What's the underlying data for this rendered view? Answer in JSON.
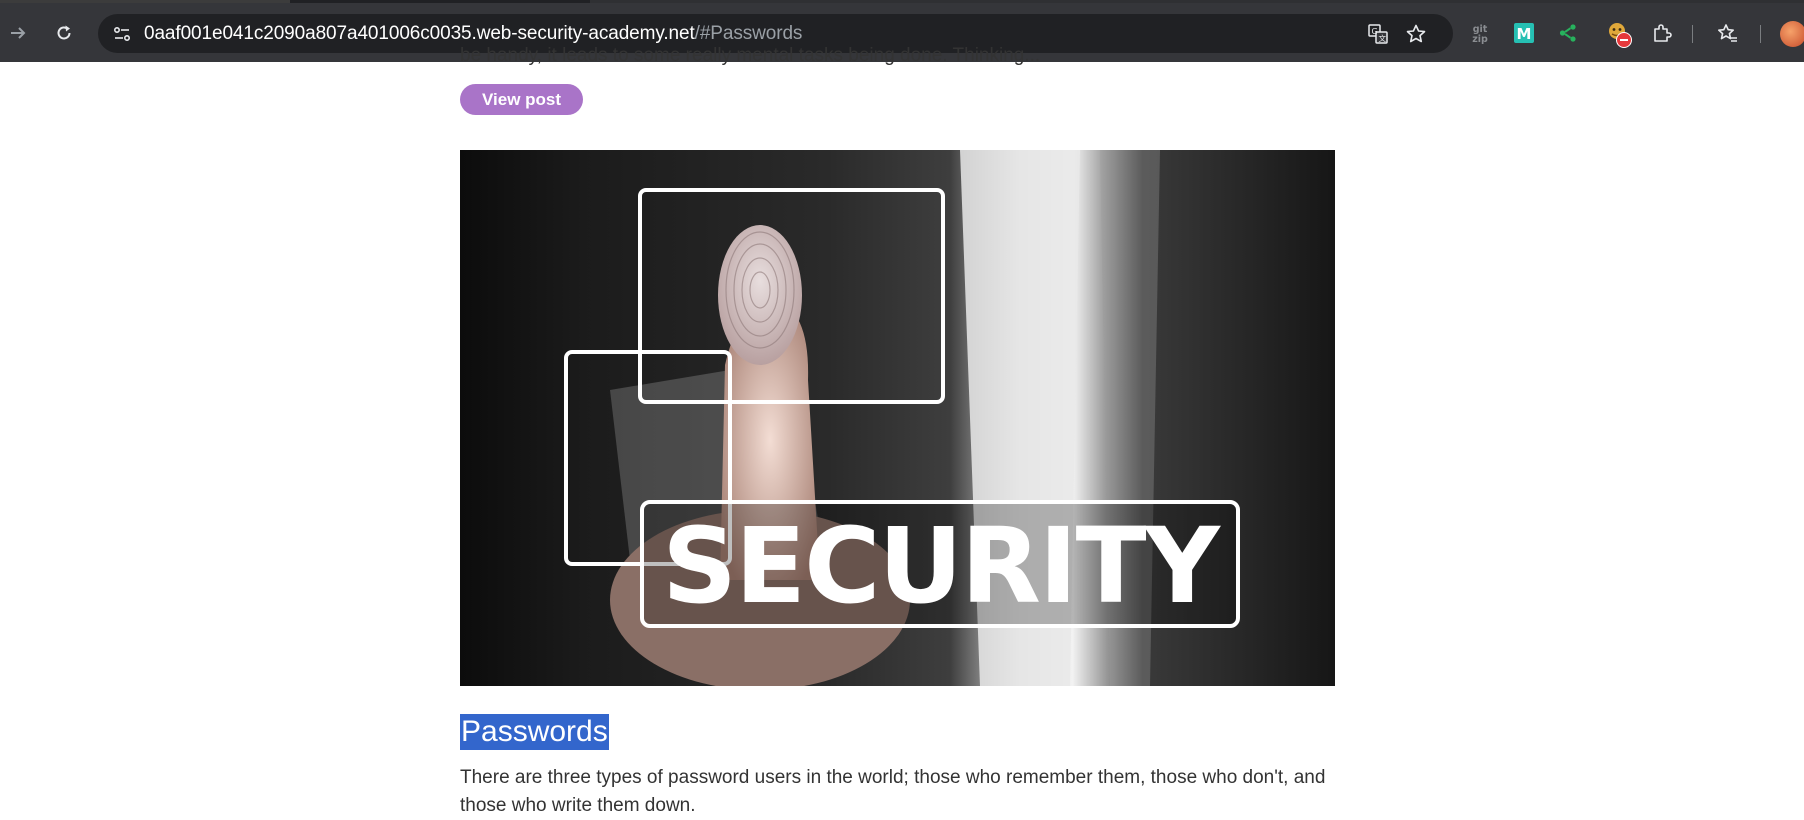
{
  "browser": {
    "url_host": "0aaf001e041c2090a807a401006c0035.web-security-academy.net",
    "url_rest": "/#Passwords",
    "colors": {
      "toolbar": "#35363a",
      "omnibox": "#202124"
    },
    "icons": [
      "forward-icon",
      "reload-icon",
      "site-info-icon",
      "translate-icon",
      "bookmark-star-icon",
      "gitzip-extension-icon",
      "m-extension-icon",
      "share-extension-icon",
      "blocked-extension-icon",
      "extensions-puzzle-icon",
      "bookmarks-icon",
      "profile-avatar"
    ],
    "gitzip_label": "git zip",
    "m_label": "M"
  },
  "post": {
    "cut_text": "be handy, it leads to some really mental tasks being done. Thinking...",
    "view_post_label": "View post",
    "image_caption": "SECURITY",
    "title": "Passwords",
    "excerpt": "There are three types of password users in the world; those who remember them, those who don't, and those who write them down.",
    "colors": {
      "button": "#a974c8",
      "selection": "#3366cc",
      "text": "#333333"
    }
  }
}
